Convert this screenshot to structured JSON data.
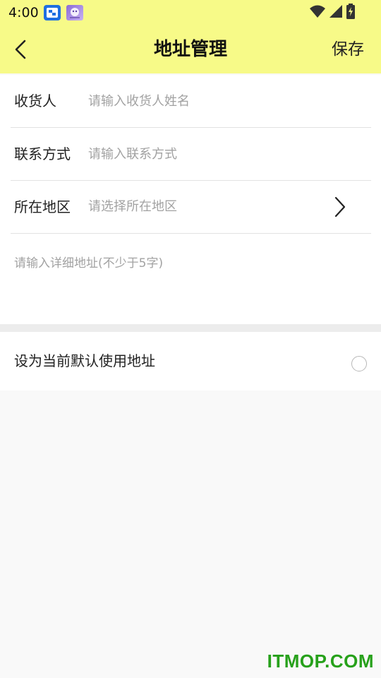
{
  "status_bar": {
    "time": "4:00",
    "icons": [
      "app-notification-icon",
      "app-notification-icon-2",
      "wifi-icon",
      "cell-signal-icon",
      "battery-charging-icon"
    ]
  },
  "header": {
    "title": "地址管理",
    "save_label": "保存",
    "back_icon": "chevron-left-icon"
  },
  "form": {
    "recipient": {
      "label": "收货人",
      "value": "",
      "placeholder": "请输入收货人姓名"
    },
    "contact": {
      "label": "联系方式",
      "value": "",
      "placeholder": "请输入联系方式"
    },
    "region": {
      "label": "所在地区",
      "placeholder": "请选择所在地区",
      "icon": "chevron-right-icon"
    },
    "detail": {
      "value": "",
      "placeholder": "请输入详细地址(不少于5字)"
    }
  },
  "default_address": {
    "label": "设为当前默认使用地址",
    "checked": false
  },
  "watermark": "ITMOP.COM",
  "colors": {
    "header_bg": "#f7fa88",
    "page_bg": "#f9f9f9",
    "card_bg": "#ffffff",
    "placeholder": "#a2a2a2",
    "watermark": "#27a11b"
  }
}
